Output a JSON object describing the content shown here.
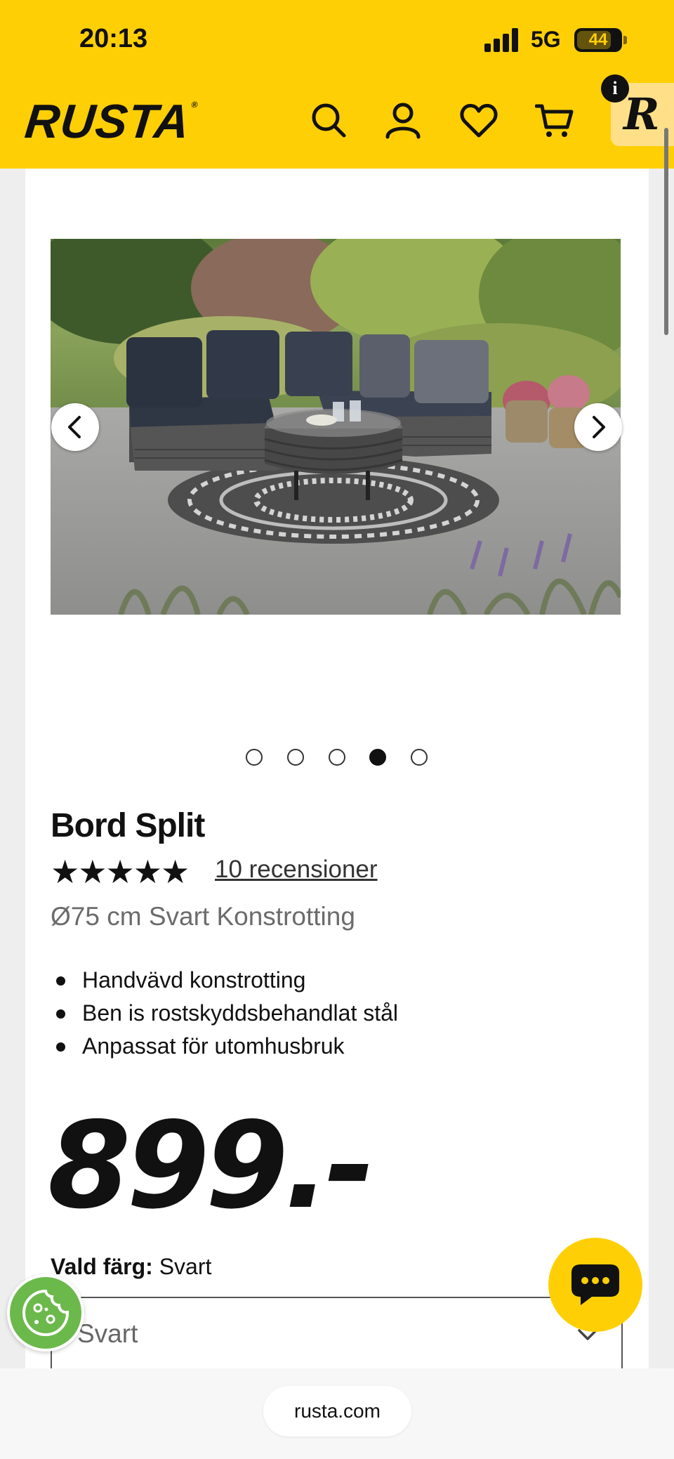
{
  "status_bar": {
    "time": "20:13",
    "network": "5G",
    "battery": "44"
  },
  "header": {
    "logo": "RUSTA",
    "logo_mark": "®",
    "badge_letter": "R",
    "info_letter": "i",
    "icons": [
      "search-icon",
      "account-icon",
      "heart-icon",
      "cart-icon"
    ],
    "brand_color": "#ffcf06"
  },
  "gallery": {
    "image_count": 5,
    "active_index": 3
  },
  "product": {
    "title": "Bord Split",
    "rating": 4.5,
    "rating_stars": "★★★★★",
    "reviews_label": "10 recensioner",
    "subtitle": "Ø75 cm Svart Konstrotting",
    "features": [
      "Handvävd konstrotting",
      "Ben is rostskyddsbehandlat stål",
      "Anpassat för utomhusbruk"
    ],
    "price": "899.-",
    "color_label": "Vald färg:",
    "color_value": "Svart",
    "select_value": "Svart"
  },
  "browser": {
    "url": "rusta.com"
  }
}
